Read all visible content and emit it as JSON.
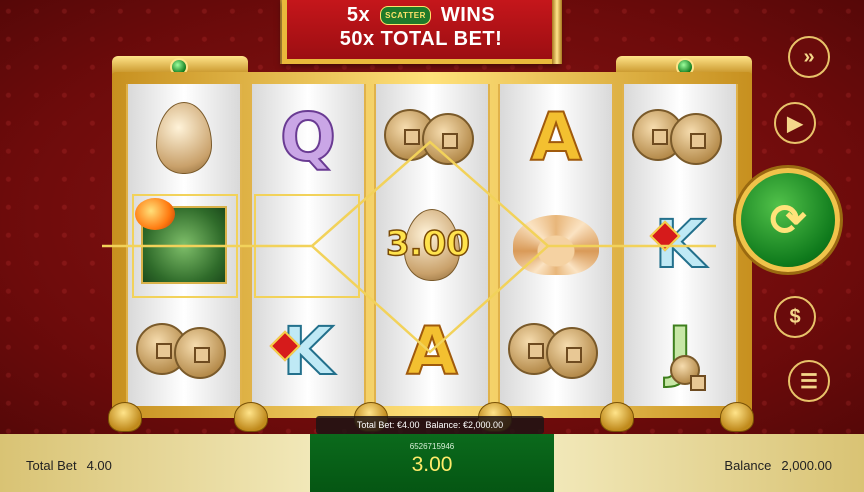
{
  "banner": {
    "line1_prefix": "5x",
    "scatter_label": "SCATTER",
    "line1_suffix": "WINS",
    "line2": "50x TOTAL BET!"
  },
  "reels": [
    [
      "egg",
      "scatter-fish",
      "coins"
    ],
    [
      "Q",
      "empty",
      "K"
    ],
    [
      "coins",
      "egg",
      "A"
    ],
    [
      "A",
      "lotus",
      "coins"
    ],
    [
      "coins",
      "K",
      "J"
    ]
  ],
  "win_display": "3.00",
  "info_bar": {
    "total_bet_label": "Total Bet:",
    "total_bet_value": "€4.00",
    "balance_label": "Balance:",
    "balance_value": "€2,000.00"
  },
  "bottom_bar": {
    "total_bet_label": "Total Bet",
    "total_bet_value": "4.00",
    "round_id": "6526715946",
    "win_amount": "3.00",
    "balance_label": "Balance",
    "balance_value": "2,000.00"
  },
  "side_buttons": [
    {
      "name": "turbo-button",
      "icon": "fast-forward-icon"
    },
    {
      "name": "autoplay-button",
      "icon": "autoplay-icon"
    },
    {
      "name": "spin-button",
      "icon": "spin-icon"
    },
    {
      "name": "bet-button",
      "icon": "dollar-icon"
    },
    {
      "name": "menu-button",
      "icon": "hamburger-icon"
    }
  ],
  "colors": {
    "background": "#7a0f0f",
    "gold": "#e9b93b",
    "win_text": "#ffe34d",
    "panel_green": "#0b6a1c"
  }
}
